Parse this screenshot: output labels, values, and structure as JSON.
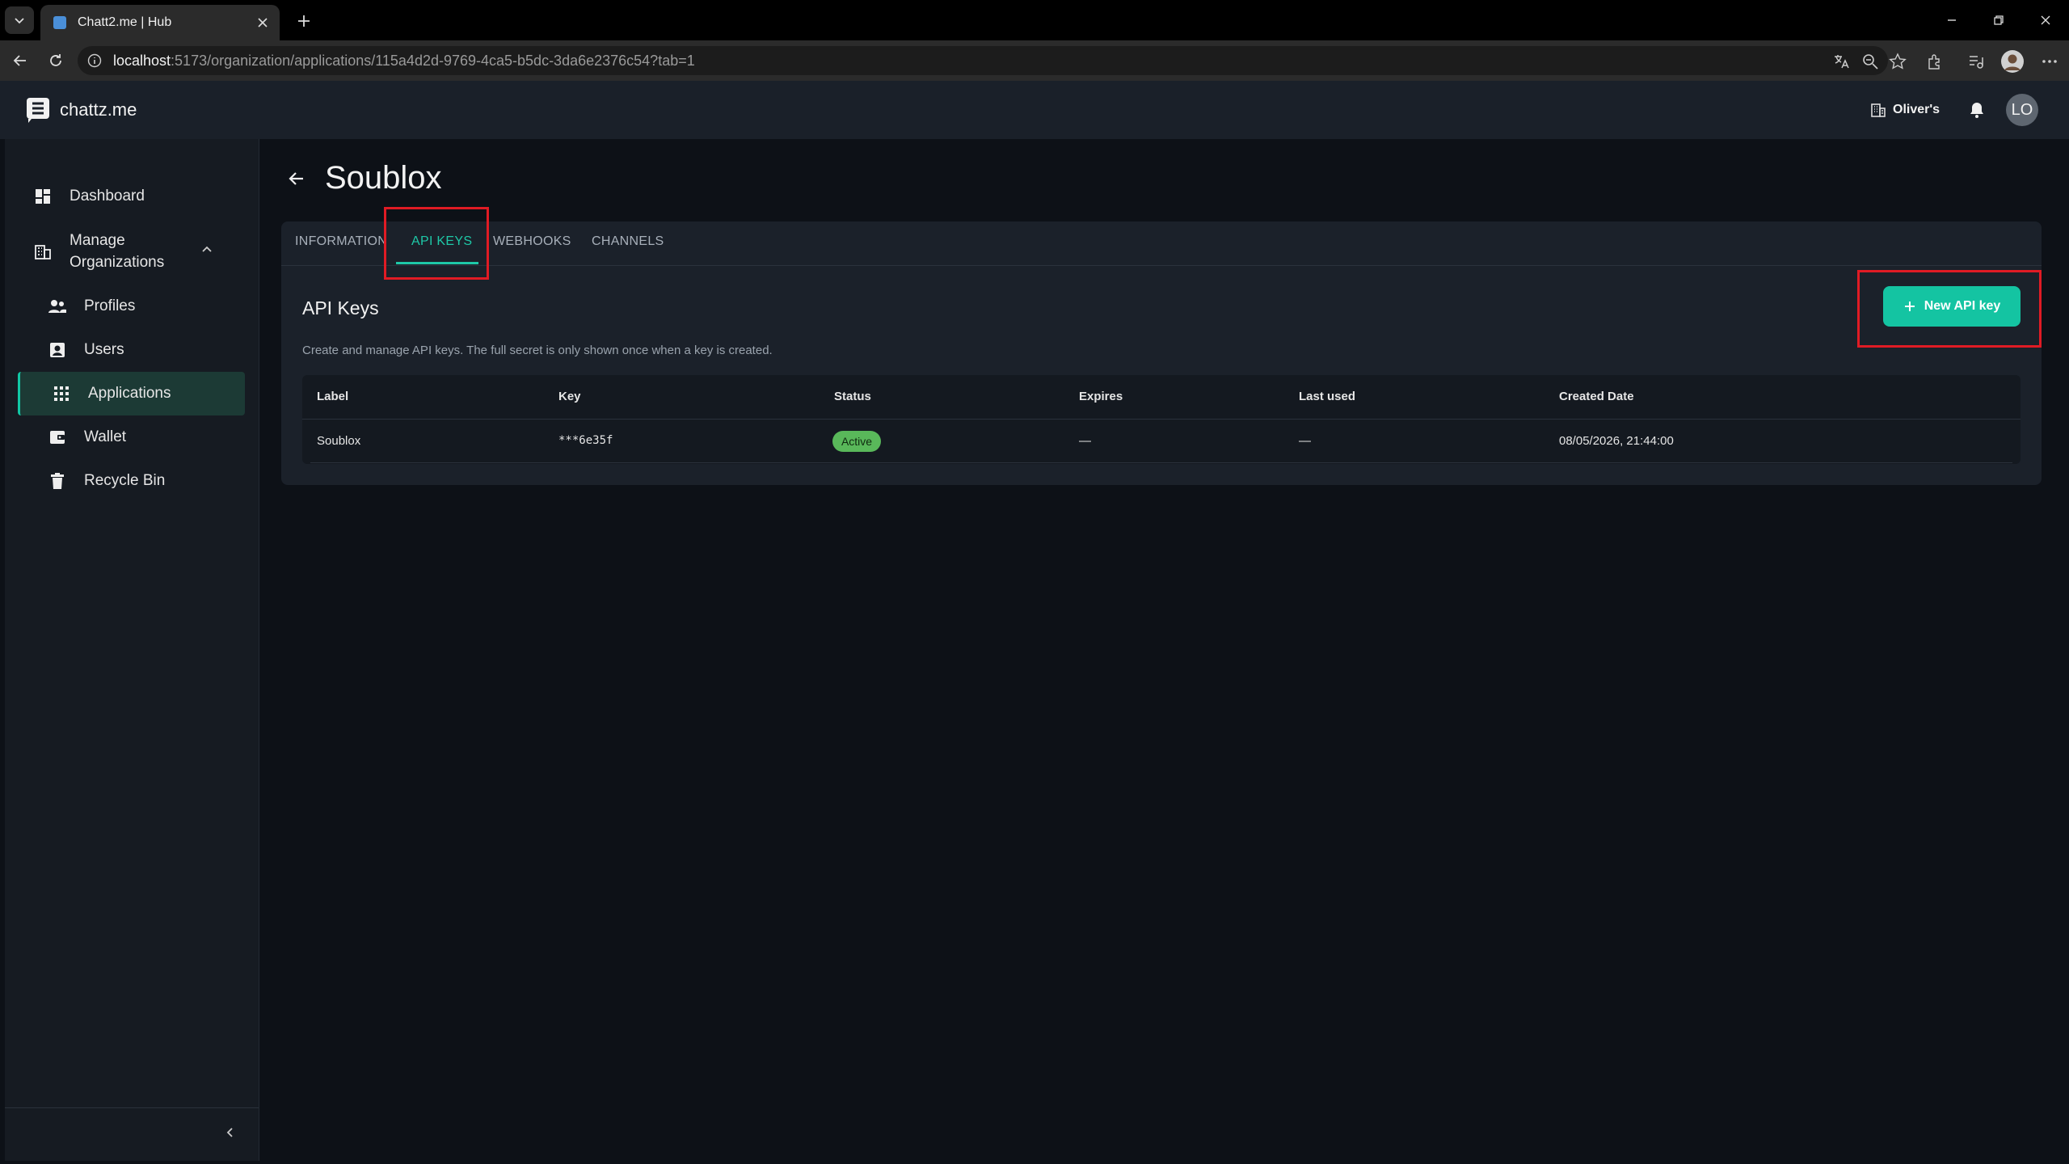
{
  "browser": {
    "tab_title": "Chatt2.me | Hub",
    "url_host": "localhost",
    "url_rest": ":5173/organization/applications/115a4d2d-9769-4ca5-b5dc-3da6e2376c54?tab=1"
  },
  "header": {
    "logo_text": "chattz.me",
    "org_name": "Oliver's",
    "avatar_initials": "LO"
  },
  "sidebar": {
    "items": [
      {
        "label": "Dashboard"
      },
      {
        "label": "Manage Organizations"
      },
      {
        "label": "Profiles"
      },
      {
        "label": "Users"
      },
      {
        "label": "Applications"
      },
      {
        "label": "Wallet"
      },
      {
        "label": "Recycle Bin"
      }
    ]
  },
  "page": {
    "title": "Soublox",
    "tabs": [
      "INFORMATION",
      "API KEYS",
      "WEBHOOKS",
      "CHANNELS"
    ],
    "active_tab": "API KEYS"
  },
  "api_keys": {
    "title": "API Keys",
    "description": "Create and manage API keys. The full secret is only shown once when a key is created.",
    "new_button": "New API key",
    "columns": [
      "Label",
      "Key",
      "Status",
      "Expires",
      "Last used",
      "Created Date"
    ],
    "rows": [
      {
        "label": "Soublox",
        "key": "***6e35f",
        "status": "Active",
        "expires": "—",
        "last_used": "—",
        "created": "08/05/2026, 21:44:00"
      }
    ]
  },
  "colors": {
    "accent": "#14c4a2",
    "highlight": "#e01b24",
    "active_badge": "#59b85a"
  }
}
